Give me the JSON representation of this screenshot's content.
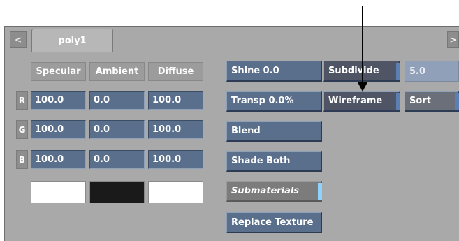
{
  "tabs": {
    "prev": "<",
    "next": ">",
    "active": "poly1"
  },
  "columns": [
    "Specular",
    "Ambient",
    "Diffuse"
  ],
  "rows": [
    {
      "label": "R",
      "values": [
        "100.0",
        "0.0",
        "100.0"
      ]
    },
    {
      "label": "G",
      "values": [
        "100.0",
        "0.0",
        "100.0"
      ]
    },
    {
      "label": "B",
      "values": [
        "100.0",
        "0.0",
        "100.0"
      ]
    }
  ],
  "swatches": {
    "specular": "#ffffff",
    "ambient": "#1a1a1a",
    "diffuse": "#ffffff"
  },
  "buttons": {
    "shine": "Shine 0.0",
    "transp": "Transp 0.0%",
    "blend": "Blend",
    "shade_both": "Shade Both",
    "submaterials": "Submaterials",
    "replace_texture": "Replace Texture",
    "subdivide": "Subdivide",
    "subdivide_value": "5.0",
    "wireframe": "Wireframe",
    "sort": "Sort"
  },
  "colors": {
    "field_blue": "#5a6f8c",
    "panel_gray": "#a9a9a9",
    "indicator": "#8fd3ff"
  }
}
